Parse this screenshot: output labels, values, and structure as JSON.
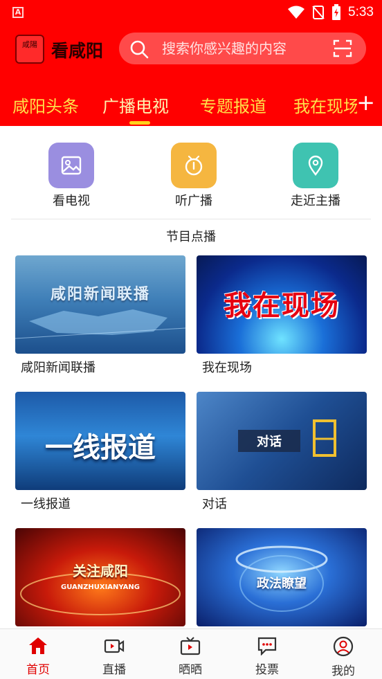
{
  "status": {
    "carrier_badge": "A",
    "time": "5:33"
  },
  "header": {
    "logo_text": "咸陽",
    "title": "看咸阳",
    "search_placeholder": "搜索你感兴趣的内容"
  },
  "tabs": [
    {
      "label": "咸阳头条"
    },
    {
      "label": "广播电视",
      "active": true
    },
    {
      "label": "专题报道"
    },
    {
      "label": "我在现场"
    }
  ],
  "tab_add_label": "+",
  "quick_entries": [
    {
      "label": "看电视",
      "icon": "image-icon",
      "color": "#9a8ee0"
    },
    {
      "label": "听广播",
      "icon": "radio-icon",
      "color": "#f5b640"
    },
    {
      "label": "走近主播",
      "icon": "location-pin-icon",
      "color": "#3fc3b1"
    }
  ],
  "section_title": "节目点播",
  "programs": [
    {
      "title": "咸阳新闻联播",
      "thumb_text": "咸阳新闻联播"
    },
    {
      "title": "我在现场",
      "thumb_text": "我在现场"
    },
    {
      "title": "一线报道",
      "thumb_text": "一线报道"
    },
    {
      "title": "对话",
      "thumb_text": "对话"
    },
    {
      "title": "",
      "thumb_text": "关注咸阳",
      "thumb_subtext": "GUANZHUXIANYANG"
    },
    {
      "title": "",
      "thumb_text": "政法瞭望"
    }
  ],
  "bottom_nav": [
    {
      "label": "首页",
      "icon": "home-icon",
      "active": true
    },
    {
      "label": "直播",
      "icon": "video-camera-icon"
    },
    {
      "label": "晒晒",
      "icon": "tv-icon"
    },
    {
      "label": "投票",
      "icon": "chat-bubble-icon"
    },
    {
      "label": "我的",
      "icon": "user-icon"
    }
  ],
  "colors": {
    "brand_red": "#ff0000",
    "tab_yellow": "#ffe24a",
    "active_nav": "#e00000"
  }
}
